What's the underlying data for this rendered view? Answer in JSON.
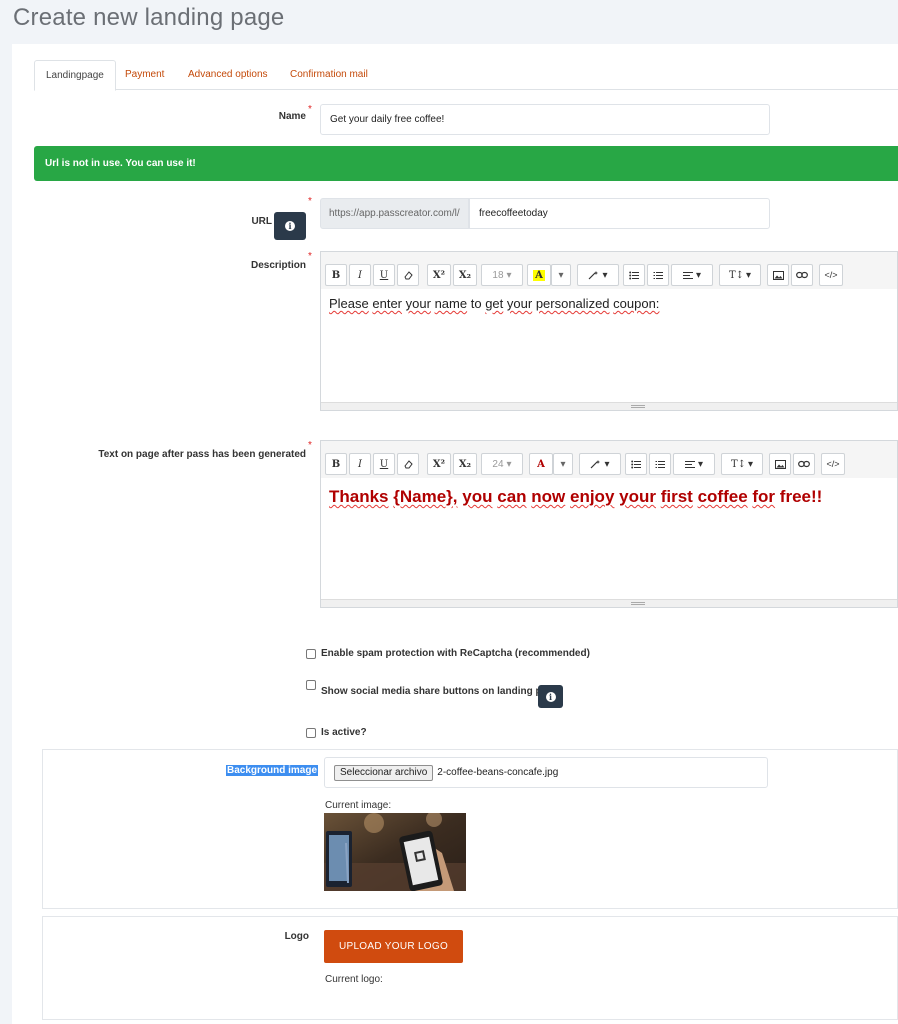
{
  "page_title": "Create new landing page",
  "tabs": [
    "Landingpage",
    "Payment",
    "Advanced options",
    "Confirmation mail"
  ],
  "form": {
    "name_label": "Name",
    "name_value": "Get your daily free coffee!",
    "required_mark": "*",
    "url_alert": "Url is not in use. You can use it!",
    "url_label": "URL",
    "url_prefix": "https://app.passcreator.com/l/",
    "url_value": "freecoffeetoday",
    "description_label": "Description",
    "description_font_size": "18",
    "description_text": [
      "Please",
      "enter",
      "your",
      "name",
      "to",
      "get",
      "your",
      "personalized",
      "coupon:"
    ],
    "after_label": "Text on page after pass has been generated",
    "after_font_size": "24",
    "after_text": [
      "Thanks",
      "{Name},",
      "you",
      "can",
      "now",
      "enjoy",
      "your",
      "first",
      "coffee",
      "for",
      "free!!"
    ],
    "after_text_color": "#b00000",
    "recaptcha_label": "Enable spam protection with ReCaptcha (recommended)",
    "social_label": "Show social media share buttons on landing page",
    "active_label": "Is active?",
    "background_label": "Background image",
    "file_button": "Seleccionar archivo",
    "file_name": "2-coffee-beans-concafe.jpg",
    "current_image_label": "Current image:",
    "logo_label": "Logo",
    "upload_logo": "UPLOAD YOUR LOGO",
    "current_logo_label": "Current logo:"
  },
  "toolbar_glyphs": {
    "bold": "B",
    "italic": "I",
    "underline": "U",
    "superscript": "X²",
    "subscript": "X₂",
    "font_color": "A",
    "caret": "▾",
    "textsize": "T↕",
    "code": "</>"
  },
  "colors": {
    "accent": "#c44a0a",
    "success": "#28a745",
    "info_button": "#2b3a4a",
    "upload_button": "#d04b0f",
    "highlight": "#ffff00"
  }
}
